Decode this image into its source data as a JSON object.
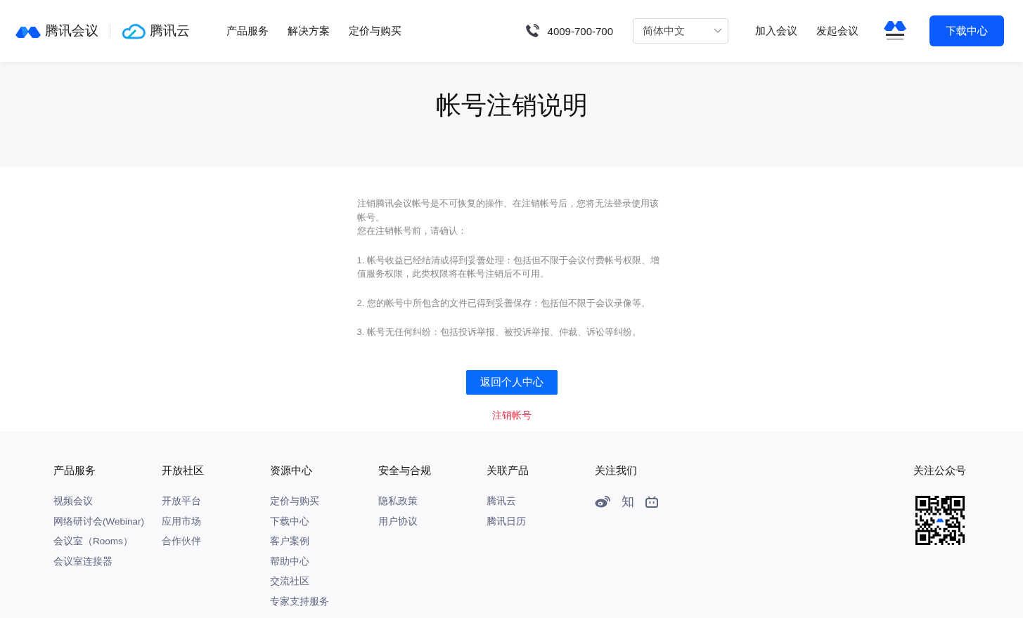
{
  "header": {
    "brand": {
      "product": "腾讯会议",
      "cloud": "腾讯云"
    },
    "nav": [
      "产品服务",
      "解决方案",
      "定价与购买"
    ],
    "phone": "4009-700-700",
    "language": {
      "value": "简体中文"
    },
    "actions": [
      "加入会议",
      "发起会议"
    ],
    "download_button": "下载中心"
  },
  "title": "帐号注销说明",
  "notice": {
    "intro": [
      "注销腾讯会议帐号是不可恢复的操作。在注销帐号后，您将无法登录使用该帐号。",
      "您在注销帐号前，请确认："
    ],
    "items": [
      "1. 帐号收益已经结清或得到妥善处理：包括但不限于会议付费帐号权限、增值服务权限，此类权限将在帐号注销后不可用。",
      "2. 您的帐号中所包含的文件已得到妥善保存：包括但不限于会议录像等。",
      "3. 帐号无任何纠纷：包括投诉举报、被投诉举报、仲裁、诉讼等纠纷。"
    ]
  },
  "back_button": "返回个人中心",
  "cancel_link": "注销帐号",
  "footer": {
    "columns": [
      {
        "heading": "产品服务",
        "links": [
          "视频会议",
          "网络研讨会(Webinar)",
          "会议室（Rooms）",
          "会议室连接器"
        ]
      },
      {
        "heading": "开放社区",
        "links": [
          "开放平台",
          "应用市场",
          "合作伙伴"
        ]
      },
      {
        "heading": "资源中心",
        "links": [
          "定价与购买",
          "下载中心",
          "客户案例",
          "帮助中心",
          "交流社区",
          "专家支持服务"
        ]
      },
      {
        "heading": "安全与合规",
        "links": [
          "隐私政策",
          "用户协议"
        ]
      },
      {
        "heading": "关联产品",
        "links": [
          "腾讯云",
          "腾讯日历"
        ]
      }
    ],
    "follow": {
      "heading": "关注我们",
      "icons": [
        {
          "kind": "weibo"
        },
        {
          "kind": "text",
          "label": "知"
        },
        {
          "kind": "tv"
        }
      ]
    },
    "qr": {
      "heading": "关注公众号"
    }
  }
}
